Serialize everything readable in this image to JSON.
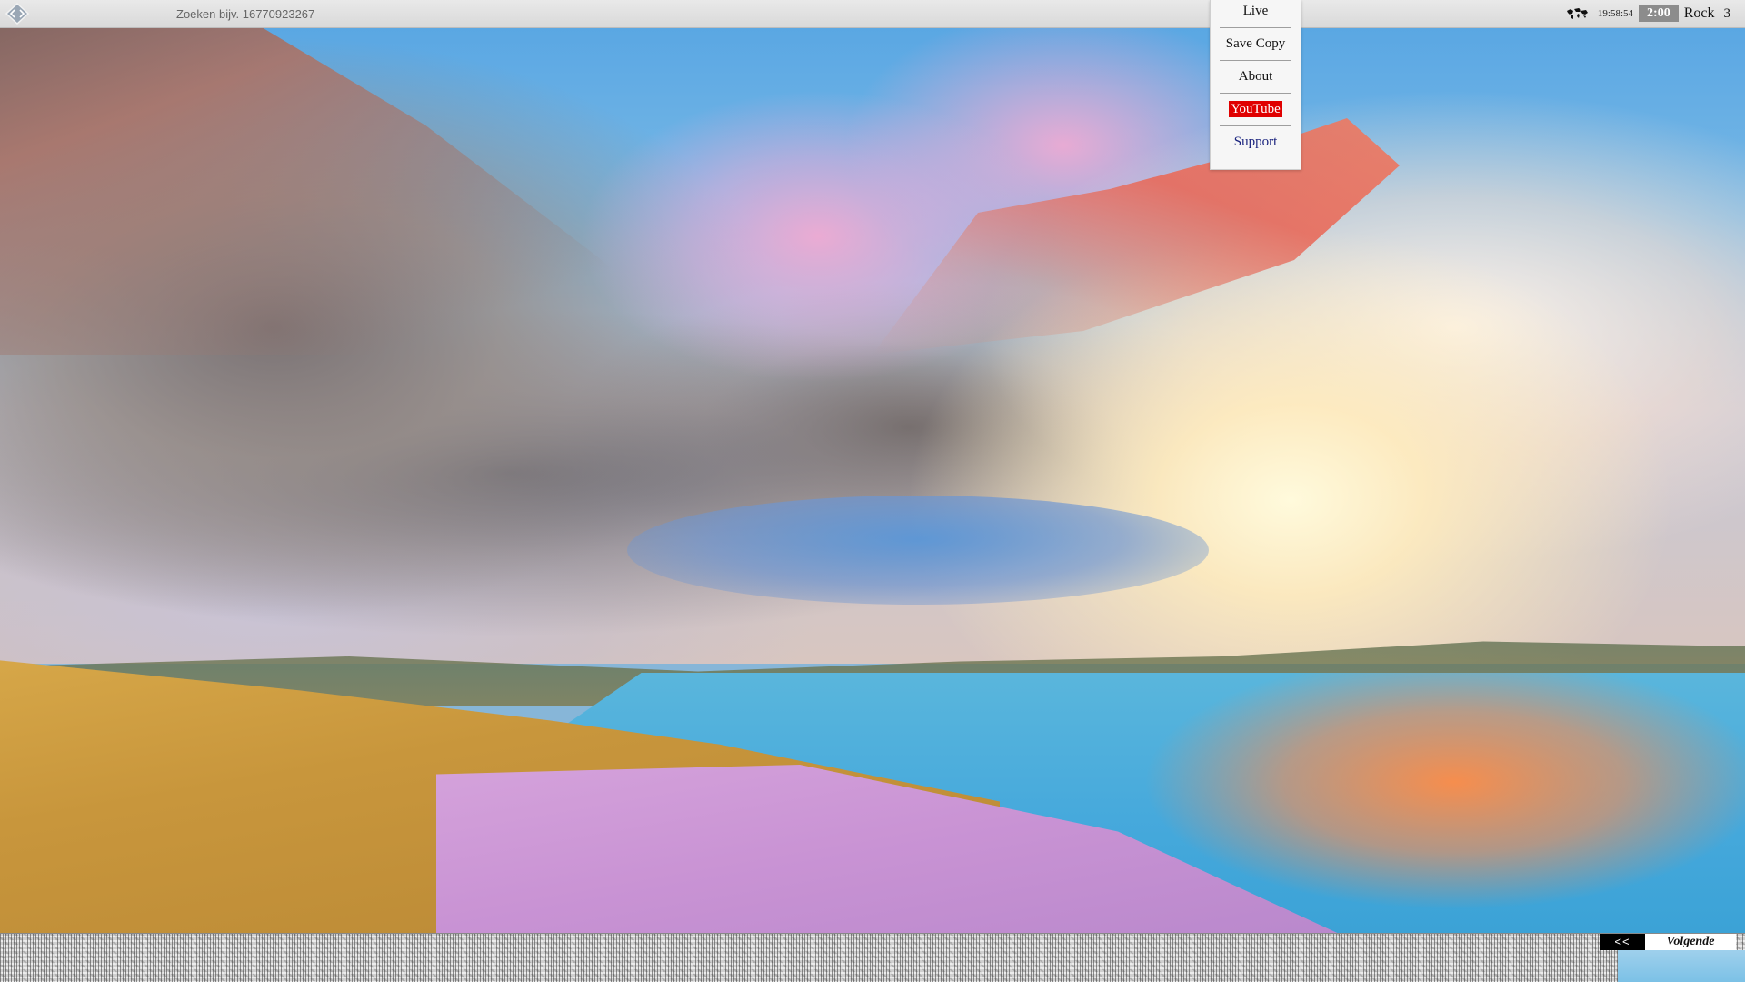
{
  "search": {
    "placeholder": "Zoeken bijv. 16770923267"
  },
  "status": {
    "clock": "19:58:54",
    "timer": "2:00",
    "genre": "Rock",
    "channel": "3",
    "map_icon": "world-map-icon"
  },
  "menu": {
    "items": [
      {
        "label": "Live"
      },
      {
        "label": "Save Copy"
      },
      {
        "label": "About"
      },
      {
        "label": "YouTube",
        "highlight": "#e00000"
      },
      {
        "label": "Support"
      }
    ]
  },
  "navigation": {
    "prev_label": "<<",
    "next_label": "Volgende"
  },
  "colors": {
    "toolbar": "#dcdcdc",
    "timer_badge": "#8c8c8c",
    "youtube": "#e00000"
  }
}
